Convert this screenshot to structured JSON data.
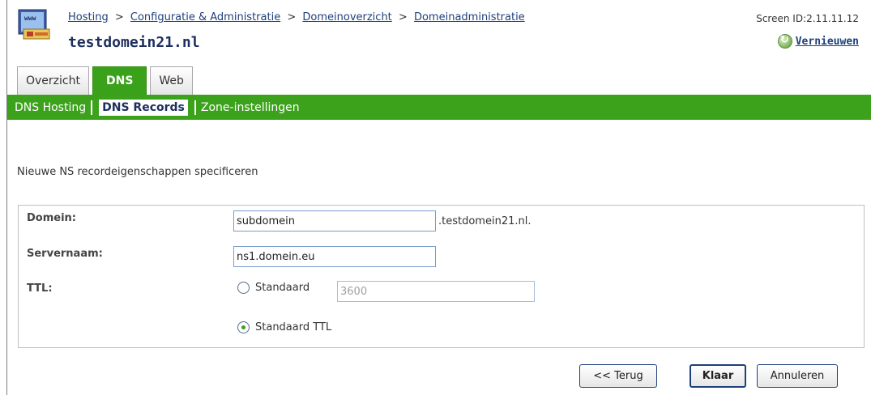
{
  "header": {
    "breadcrumb": [
      "Hosting",
      "Configuratie & Administratie",
      "Domeinoverzicht",
      "Domeinadministratie"
    ],
    "breadcrumb_sep": ">",
    "title": "testdomein21.nl",
    "screen_id": "Screen ID:2.11.11.12",
    "refresh_label": "Vernieuwen",
    "refresh_icon": "refresh-icon",
    "app_icon": "hosting-globe-icon"
  },
  "tabs": [
    {
      "label": "Overzicht",
      "active": false
    },
    {
      "label": "DNS",
      "active": true
    },
    {
      "label": "Web",
      "active": false
    }
  ],
  "subnav": [
    {
      "label": "DNS Hosting",
      "active": false
    },
    {
      "label": "DNS Records",
      "active": true
    },
    {
      "label": "Zone-instellingen",
      "active": false
    }
  ],
  "intro": "Nieuwe NS recordeigenschappen specificeren",
  "form": {
    "domain_label": "Domein:",
    "domain_value": "subdomein",
    "domain_suffix": ".testdomein21.nl.",
    "server_label": "Servernaam:",
    "server_value": "ns1.domein.eu",
    "ttl_label": "TTL:",
    "ttl_custom_label": "Standaard",
    "ttl_custom_value": "3600",
    "ttl_default_label": "Standaard TTL",
    "ttl_selected": "default"
  },
  "buttons": {
    "back": "<< Terug",
    "done": "Klaar",
    "cancel": "Annuleren"
  },
  "colors": {
    "accent_green": "#3ca21c",
    "link_blue": "#1e3f7a",
    "title_navy": "#1d2f5c"
  }
}
